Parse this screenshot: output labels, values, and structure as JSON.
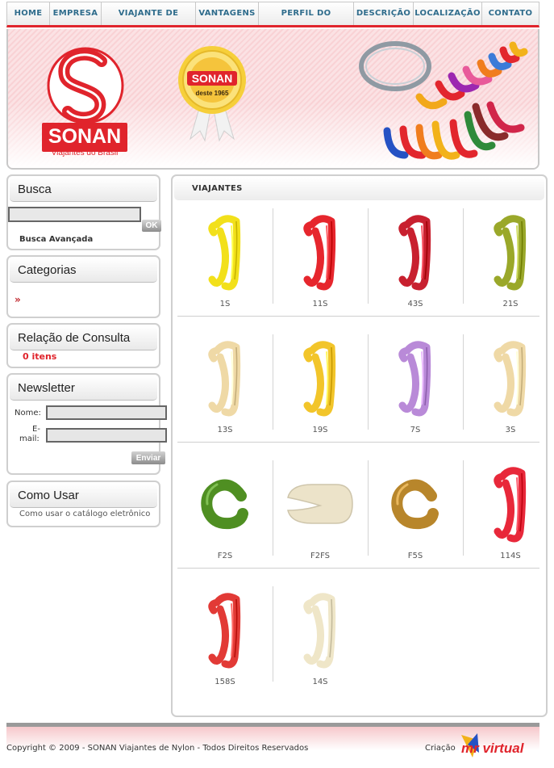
{
  "nav": {
    "items": [
      {
        "label": "HOME"
      },
      {
        "label": "EMPRESA"
      },
      {
        "label": "VIAJANTE DE NYLON"
      },
      {
        "label": "VANTAGENS"
      },
      {
        "label": "PERFIL DO VIAJANTE"
      },
      {
        "label": "DESCRIÇÃO"
      },
      {
        "label": "LOCALIZAÇÃO"
      },
      {
        "label": "CONTATO"
      }
    ]
  },
  "banner": {
    "brand": "SONAN",
    "tagline": "Viajantes do Brasil",
    "seal_brand": "SONAN",
    "seal_since": "deste 1965"
  },
  "sidebar": {
    "busca": {
      "title": "Busca",
      "input_value": "",
      "ok_label": "OK",
      "advanced": "Busca Avançada"
    },
    "categorias": {
      "title": "Categorias",
      "arrow": "»"
    },
    "relacao": {
      "title": "Relação de Consulta",
      "count": "0 itens"
    },
    "newsletter": {
      "title": "Newsletter",
      "name_label": "Nome:",
      "email_label_1": "E-",
      "email_label_2": "mail:",
      "send_label": "Enviar"
    },
    "como_usar": {
      "title": "Como Usar",
      "link": "Como usar o catálogo eletrônico"
    }
  },
  "main": {
    "title": "VIAJANTES",
    "products": [
      {
        "code": "1S",
        "color": "#f2e01a",
        "shape": "hook"
      },
      {
        "code": "11S",
        "color": "#e6262d",
        "shape": "hook"
      },
      {
        "code": "43S",
        "color": "#c8202f",
        "shape": "hook"
      },
      {
        "code": "21S",
        "color": "#9aa82a",
        "shape": "hook"
      },
      {
        "code": "13S",
        "color": "#efd9a6",
        "shape": "hook"
      },
      {
        "code": "19S",
        "color": "#f2c52a",
        "shape": "hook"
      },
      {
        "code": "7S",
        "color": "#b98ad8",
        "shape": "hook"
      },
      {
        "code": "3S",
        "color": "#efd9a6",
        "shape": "hook"
      },
      {
        "code": "F2S",
        "color": "#4f8f22",
        "shape": "c"
      },
      {
        "code": "F2FS",
        "color": "#ece3c9",
        "shape": "flat"
      },
      {
        "code": "F5S",
        "color": "#b8862b",
        "shape": "c"
      },
      {
        "code": "114S",
        "color": "#e8283a",
        "shape": "hook"
      },
      {
        "code": "158S",
        "color": "#e23a36",
        "shape": "hook"
      },
      {
        "code": "14S",
        "color": "#efe6c8",
        "shape": "hook"
      }
    ]
  },
  "footer": {
    "copyright": "Copyright © 2009 - SONAN Viajantes de Nylon - Todos Direitos Reservados",
    "criacao": "Criação",
    "brand": "mr virtual"
  }
}
